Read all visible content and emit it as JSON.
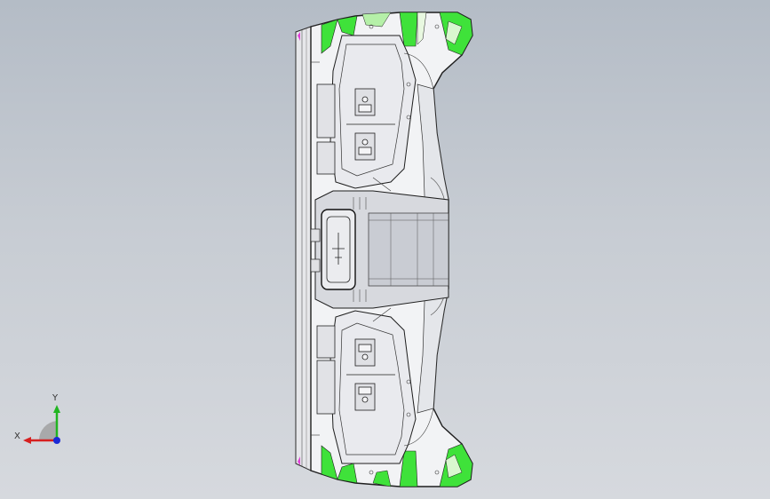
{
  "viewport": {
    "background_top": "#b4bcc6",
    "background_bottom": "#d6d9de"
  },
  "model": {
    "icon": "cad-part-front-view",
    "body_fill": "#f2f3f5",
    "edge_color": "#2b2b2b",
    "highlight_green": "#3fe23a",
    "highlight_magenta": "#e040d8",
    "shade_gray": "#c9ccd3"
  },
  "triad": {
    "x_label": "X",
    "y_label": "Y",
    "x_color": "#d62020",
    "y_color": "#21b521",
    "z_color": "#1a2ad6"
  }
}
